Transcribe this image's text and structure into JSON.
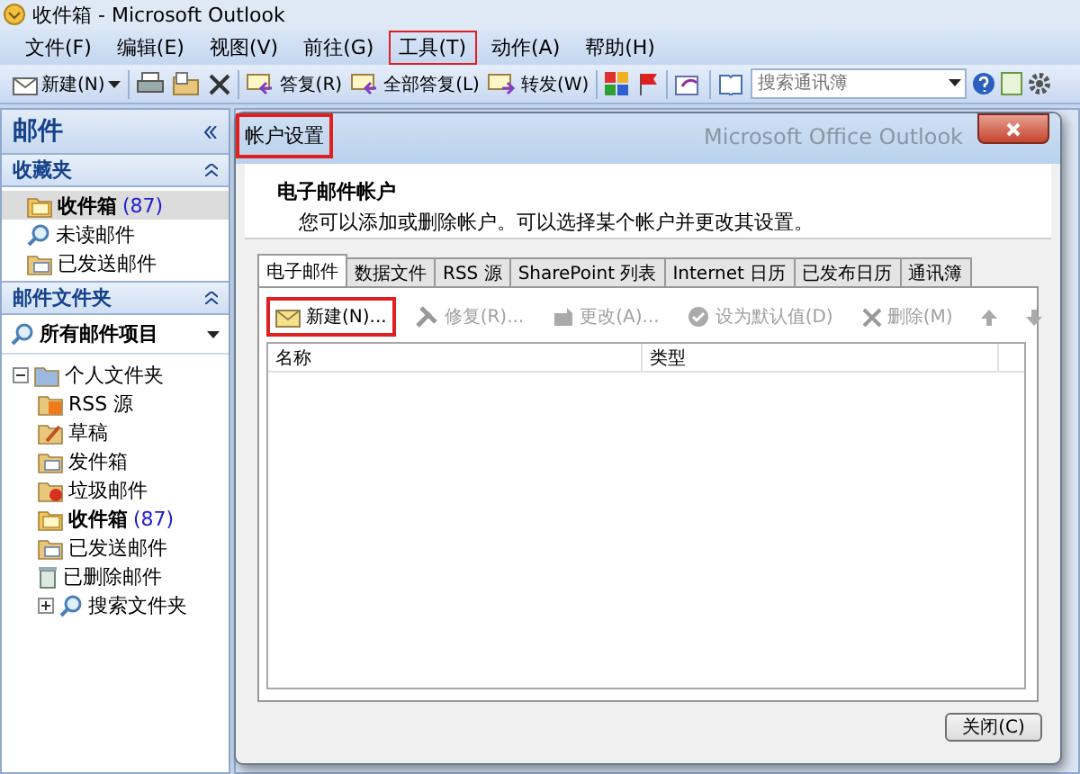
{
  "window": {
    "title": "收件箱 - Microsoft Outlook"
  },
  "menu": [
    {
      "label": "文件(F)",
      "highlighted": false
    },
    {
      "label": "编辑(E)",
      "highlighted": false
    },
    {
      "label": "视图(V)",
      "highlighted": false
    },
    {
      "label": "前往(G)",
      "highlighted": false
    },
    {
      "label": "工具(T)",
      "highlighted": true
    },
    {
      "label": "动作(A)",
      "highlighted": false
    },
    {
      "label": "帮助(H)",
      "highlighted": false
    }
  ],
  "toolbar": {
    "items": [
      {
        "kind": "new",
        "label": "新建(N)"
      },
      {
        "kind": "print"
      },
      {
        "kind": "move"
      },
      {
        "kind": "delete"
      },
      {
        "kind": "reply",
        "label": "答复(R)"
      },
      {
        "kind": "reply-all",
        "label": "全部答复(L)"
      },
      {
        "kind": "forward",
        "label": "转发(W)"
      },
      {
        "kind": "categories"
      },
      {
        "kind": "flag"
      },
      {
        "kind": "send-receive"
      },
      {
        "kind": "address-book"
      }
    ],
    "search": {
      "placeholder": "搜索通讯簿"
    }
  },
  "nav": {
    "title": "邮件",
    "favorites": {
      "title": "收藏夹",
      "items": [
        {
          "kind": "inbox",
          "label": "收件箱",
          "count": "(87)",
          "selected": true,
          "unread": true
        },
        {
          "kind": "search",
          "label": "未读邮件",
          "selected": false,
          "unread": false
        },
        {
          "kind": "sent",
          "label": "已发送邮件",
          "selected": false,
          "unread": false
        }
      ]
    },
    "folders": {
      "title": "邮件文件夹",
      "view": "所有邮件项目",
      "tree": [
        {
          "kind": "personal",
          "label": "个人文件夹",
          "expanded": true,
          "children": [
            {
              "kind": "rss",
              "label": "RSS 源",
              "unread": false
            },
            {
              "kind": "drafts",
              "label": "草稿",
              "unread": false
            },
            {
              "kind": "outbox",
              "label": "发件箱",
              "unread": false
            },
            {
              "kind": "junk",
              "label": "垃圾邮件",
              "unread": false
            },
            {
              "kind": "inbox",
              "label": "收件箱",
              "count": "(87)",
              "unread": true
            },
            {
              "kind": "sent",
              "label": "已发送邮件",
              "unread": false
            },
            {
              "kind": "deleted",
              "label": "已删除邮件",
              "unread": false
            },
            {
              "kind": "search",
              "label": "搜索文件夹",
              "unread": false,
              "expanded": false
            }
          ]
        }
      ]
    }
  },
  "background_dialog": {
    "title": "Microsoft Office Outlook"
  },
  "dialog": {
    "title": "帐户设置",
    "title_highlighted": true,
    "heading": "电子邮件帐户",
    "description": "您可以添加或删除帐户。可以选择某个帐户并更改其设置。",
    "tabs": [
      {
        "label": "电子邮件",
        "selected": true
      },
      {
        "label": "数据文件",
        "selected": false
      },
      {
        "label": "RSS 源",
        "selected": false
      },
      {
        "label": "SharePoint 列表",
        "selected": false
      },
      {
        "label": "Internet 日历",
        "selected": false
      },
      {
        "label": "已发布日历",
        "selected": false
      },
      {
        "label": "通讯簿",
        "selected": false
      }
    ],
    "actions": [
      {
        "kind": "new",
        "label": "新建(N)...",
        "disabled": false,
        "highlighted": true
      },
      {
        "kind": "repair",
        "label": "修复(R)...",
        "disabled": true,
        "highlighted": false
      },
      {
        "kind": "change",
        "label": "更改(A)...",
        "disabled": true,
        "highlighted": false
      },
      {
        "kind": "default",
        "label": "设为默认值(D)",
        "disabled": true,
        "highlighted": false
      },
      {
        "kind": "remove",
        "label": "删除(M)",
        "disabled": true,
        "highlighted": false
      },
      {
        "kind": "up",
        "disabled": true,
        "highlighted": false
      },
      {
        "kind": "down",
        "disabled": true,
        "highlighted": false
      }
    ],
    "columns": [
      "名称",
      "类型"
    ],
    "close_button": "关闭(C)"
  }
}
